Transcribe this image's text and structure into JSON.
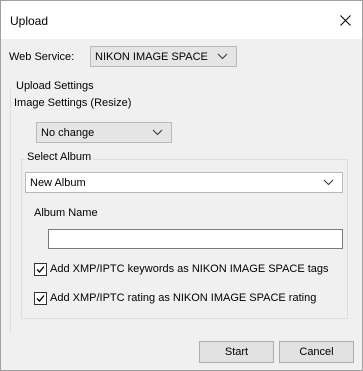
{
  "window": {
    "title": "Upload"
  },
  "web_service": {
    "label": "Web Service:",
    "selected": "NIKON IMAGE SPACE"
  },
  "upload_settings": {
    "legend": "Upload Settings",
    "image_settings_label": "Image Settings (Resize)",
    "resize_selected": "No change",
    "select_album": {
      "legend": "Select Album",
      "album_selected": "New Album",
      "album_name_label": "Album Name",
      "album_name_value": ""
    },
    "checkboxes": [
      {
        "label": "Add XMP/IPTC keywords as NIKON IMAGE SPACE tags",
        "checked": true
      },
      {
        "label": "Add XMP/IPTC rating as NIKON IMAGE SPACE rating",
        "checked": true
      }
    ]
  },
  "buttons": {
    "start": "Start",
    "cancel": "Cancel"
  }
}
